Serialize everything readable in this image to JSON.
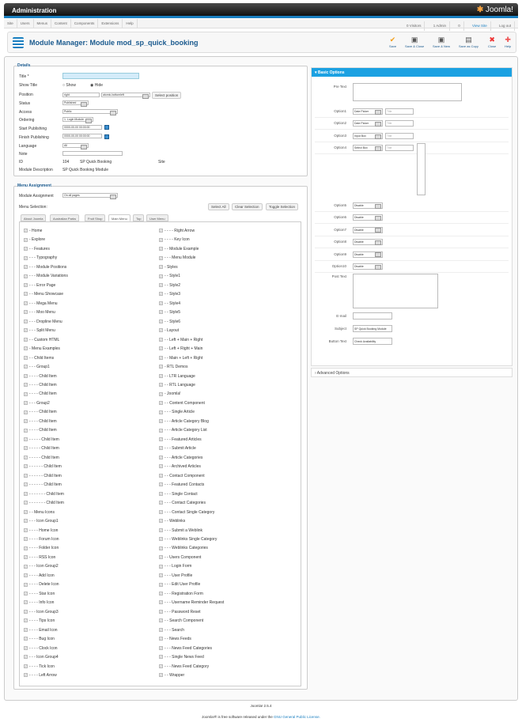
{
  "header": {
    "title": "Administration",
    "logo": "Joomla!"
  },
  "menu": [
    "Site",
    "Users",
    "Menus",
    "Content",
    "Components",
    "Extensions",
    "Help"
  ],
  "status": {
    "visitors": "0 Visitors",
    "admins": "1 Admin",
    "messages": "0",
    "view_site": "View Site",
    "logout": "Log out"
  },
  "toolbar": {
    "title": "Module Manager: Module mod_sp_quick_booking",
    "save": "Save",
    "save_close": "Save & Close",
    "save_new": "Save & New",
    "save_copy": "Save as Copy",
    "close": "Close",
    "help": "Help"
  },
  "details": {
    "legend": "Details",
    "title_label": "Title *",
    "title_value": "",
    "show_title_label": "Show Title",
    "show": "Show",
    "hide": "Hide",
    "position_label": "Position",
    "position_value": "right",
    "position_select": "atomic-bottomleft",
    "select_position": "Select position",
    "status_label": "Status",
    "status_value": "Published",
    "access_label": "Access",
    "access_value": "Public",
    "ordering_label": "Ordering",
    "ordering_value": "1. Login Module",
    "start_label": "Start Publishing",
    "start_value": "0000-00-00 00:00:00",
    "finish_label": "Finish Publishing",
    "finish_value": "0000-00-00 00:00:00",
    "language_label": "Language",
    "language_value": "All",
    "note_label": "Note",
    "id_label": "ID",
    "id_value": "104",
    "module_name": "SP Quick Booking",
    "client": "Site",
    "desc_label": "Module Description",
    "desc_value": "SP Quick Booking Module"
  },
  "assignment": {
    "legend": "Menu Assignment",
    "module_assignment_label": "Module Assignment",
    "module_assignment_value": "On all pages",
    "menu_selection_label": "Menu Selection:",
    "select_all": "Select All",
    "clear_selection": "Clear Selection",
    "toggle_selection": "Toggle Selection",
    "tabs": [
      "About Joomla",
      "Australian Parks",
      "Fruit Shop",
      "Main Menu",
      "Top",
      "User Menu"
    ],
    "active_tab": "Main Menu",
    "left_items": [
      "- Home",
      "- Explore",
      "- - Features",
      "- - - Typography",
      "- - - Module Positions",
      "- - - Module Variations",
      "- - - Error Page",
      "- - Menu Showcase",
      "- - - Mega Menu",
      "- - - Moo Menu",
      "- - - Dropline Menu",
      "- - - Split Menu",
      "- - Custom HTML",
      "- Menu Examples",
      "- - Child Items",
      "- - - Group1",
      "- - - - Child Item",
      "- - - - Child Item",
      "- - - - Child Item",
      "- - - Group2",
      "- - - - Child Item",
      "- - - - Child Item",
      "- - - - Child Item",
      "- - - - - Child Item",
      "- - - - - Child Item",
      "- - - - - Child Item",
      "- - - - - - Child Item",
      "- - - - - - Child Item",
      "- - - - - - Child Item",
      "- - - - - - - Child Item",
      "- - - - - - - Child Item",
      "- - Menu Icons",
      "- - - Icon Group1",
      "- - - - Home Icon",
      "- - - - Forum Icon",
      "- - - - Folder Icon",
      "- - - - RSS Icon",
      "- - - Icon Group2",
      "- - - - Add Icon",
      "- - - - Delete Icon",
      "- - - - Star Icon",
      "- - - - Info Icon",
      "- - - Icon Group3",
      "- - - - Tips Icon",
      "- - - - Email Icon",
      "- - - - Bug Icon",
      "- - - - Clock Icon",
      "- - - Icon Group4",
      "- - - - Tick Icon",
      "- - - - Left Arrow"
    ],
    "right_items": [
      "- - - - Right Arrow",
      "- - - - Key Icon",
      "- - Module Example",
      "- - - Menu Module",
      "- Styles",
      "- - Style1",
      "- - Style2",
      "- - Style3",
      "- - Style4",
      "- - Style5",
      "- - Style6",
      "- Layout",
      "- - Left + Main + Right",
      "- - Left + Right + Main",
      "- - Main + Left + Right",
      "- RTL Demos",
      "- - LTR Language",
      "- - RTL Language",
      "- Joomla!",
      "- - Content Component",
      "- - - Single Article",
      "- - - Article Category Blog",
      "- - - Article Category List",
      "- - - Featured Articles",
      "- - - Submit Article",
      "- - - Article Categories",
      "- - - Archived Articles",
      "- - Contact Component",
      "- - - Featured Contacts",
      "- - - Single Contact",
      "- - - Contact Categories",
      "- - - Contact Single Category",
      "- - Weblinks",
      "- - - Submit a Weblink",
      "- - - Weblinks Single Category",
      "- - - Weblinks Categories",
      "- - Users Component",
      "- - - Login Form",
      "- - - User Profile",
      "- - - Edit User Profile",
      "- - - Registration Form",
      "- - - Username Reminder Request",
      "- - - Password Reset",
      "- - Search Component",
      "- - - Search",
      "- - News Feeds",
      "- - - News Feed Categories",
      "- - - Single News Feed",
      "- - - News Feed Category",
      "- - Wrapper"
    ]
  },
  "options": {
    "header": "Basic Options",
    "pre_text": "Pre Text",
    "post_text": "Post Text",
    "fields": [
      {
        "label": "Option1",
        "value": "Date Picker",
        "title": "Title"
      },
      {
        "label": "Option2",
        "value": "Date Picker",
        "title": "Title"
      },
      {
        "label": "Option3",
        "value": "Input Box",
        "title": "Title"
      },
      {
        "label": "Option4",
        "value": "Select Box",
        "title": "Title"
      }
    ],
    "disabled": [
      {
        "label": "Option5",
        "value": "Disable"
      },
      {
        "label": "Option6",
        "value": "Disable"
      },
      {
        "label": "Option7",
        "value": "Disable"
      },
      {
        "label": "Option8",
        "value": "Disable"
      },
      {
        "label": "Option9",
        "value": "Disable"
      },
      {
        "label": "Option10",
        "value": "Disable"
      }
    ],
    "email_label": "E-mail",
    "email_value": "",
    "subject_label": "Subject",
    "subject_value": "SP Quick Booking Module",
    "button_label": "Button Text",
    "button_value": "Check Availability",
    "advanced": "Advanced Options"
  },
  "footer": {
    "version": "Joomla! 2.5.4",
    "license_pre": "Joomla!® is free software released under the ",
    "license_link": "GNU General Public License."
  },
  "colors": {
    "accent": "#1ba1e2",
    "title": "#1a5a8e"
  }
}
